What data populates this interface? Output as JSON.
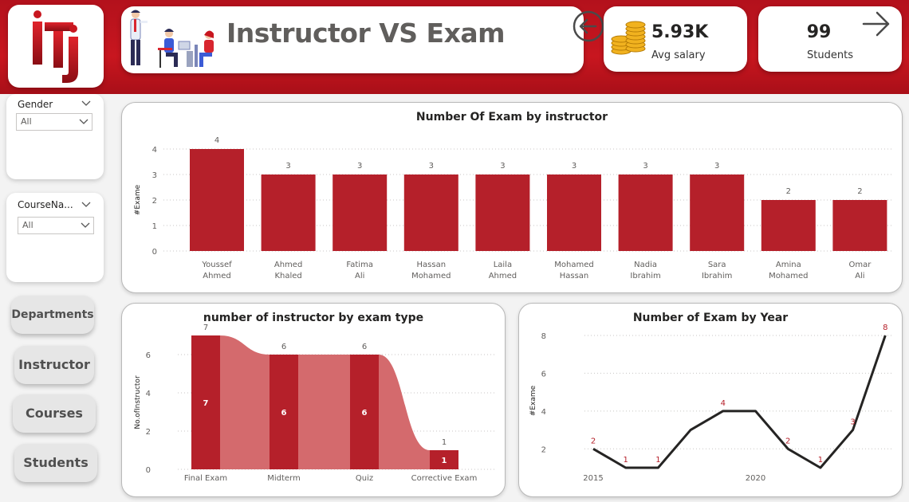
{
  "header": {
    "title": "Instructor VS Exam",
    "avg_salary": {
      "value": "5.93K",
      "label": "Avg salary"
    },
    "students": {
      "value": "99",
      "label": "Students"
    }
  },
  "colors": {
    "brand_red": "#c8161f",
    "bar_red": "#b5202a",
    "ribbon_red": "#d46a6d",
    "line": "#252423"
  },
  "slicers": [
    {
      "title": "Gender",
      "value": "All"
    },
    {
      "title": "CourseNa...",
      "value": "All"
    }
  ],
  "nav": {
    "departments": "Departments",
    "instructor": "Instructor",
    "courses": "Courses",
    "students": "Students"
  },
  "icons": [
    "logo-iti",
    "people-illustration-icon",
    "back-arrow-icon",
    "coins-icon",
    "forward-arrow-icon",
    "chevron-down-icon"
  ],
  "chart_data": [
    {
      "type": "bar",
      "title": "Number Of Exam by instructor",
      "ylabel": "#Exame",
      "ylim": [
        0,
        4
      ],
      "yticks": [
        0,
        1,
        2,
        3,
        4
      ],
      "categories": [
        "Youssef Ahmed",
        "Ahmed Khaled",
        "Fatima Ali",
        "Hassan Mohamed",
        "Laila Ahmed",
        "Mohamed Hassan",
        "Nadia Ibrahim",
        "Sara Ibrahim",
        "Amina Mohamed",
        "Omar Ali"
      ],
      "values": [
        4,
        3,
        3,
        3,
        3,
        3,
        3,
        3,
        2,
        2
      ],
      "grid": true
    },
    {
      "type": "bar",
      "subtype": "ribbon",
      "title": "number of instructor by exam type",
      "ylabel": "No.ofInstructor",
      "ylim": [
        0,
        7
      ],
      "yticks": [
        0,
        2,
        4,
        6
      ],
      "categories": [
        "Final Exam",
        "Midterm",
        "Quiz",
        "Corrective Exam"
      ],
      "values": [
        7,
        6,
        6,
        1
      ],
      "grid": true
    },
    {
      "type": "line",
      "title": "Number of Exam by Year",
      "ylabel": "#Exame",
      "ylim": [
        1,
        8
      ],
      "yticks": [
        2,
        4,
        6,
        8
      ],
      "xticks": [
        2015,
        2020
      ],
      "x": [
        2015,
        2016,
        2017,
        2018,
        2019,
        2020,
        2021,
        2022,
        2023,
        2024
      ],
      "values": [
        2,
        1,
        1,
        3,
        4,
        4,
        2,
        1,
        3,
        8
      ],
      "labels": [
        "2",
        "1",
        "1",
        "",
        "4",
        "",
        "2",
        "1",
        "3",
        "8"
      ],
      "grid": true
    }
  ]
}
